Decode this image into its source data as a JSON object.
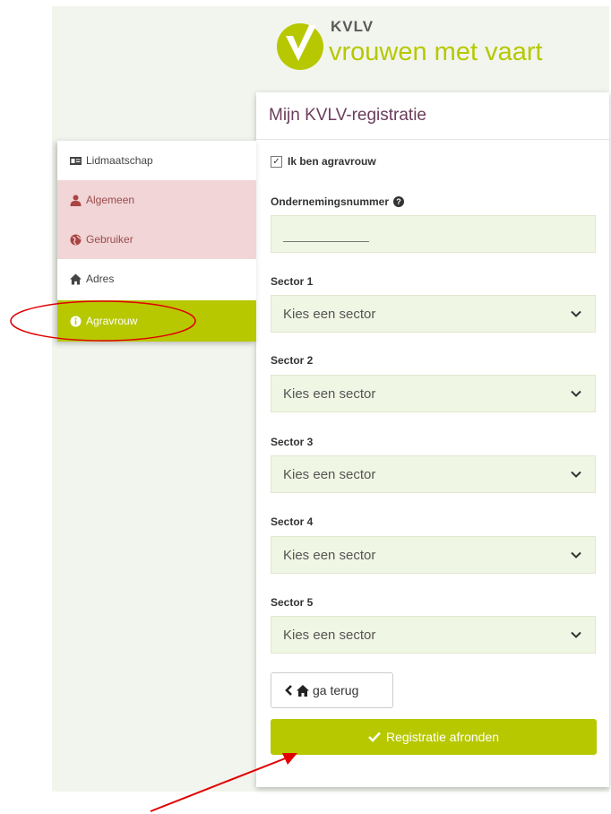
{
  "brand": {
    "name": "KVLV",
    "tagline": "vrouwen met vaart"
  },
  "card": {
    "title": "Mijn KVLV-registratie"
  },
  "checkbox": {
    "label": "Ik ben agravrouw",
    "checked": true
  },
  "company_number": {
    "label": "Ondernemingsnummer",
    "value": ""
  },
  "sectors": [
    {
      "label": "Sector 1",
      "placeholder": "Kies een sector"
    },
    {
      "label": "Sector 2",
      "placeholder": "Kies een sector"
    },
    {
      "label": "Sector 3",
      "placeholder": "Kies een sector"
    },
    {
      "label": "Sector 4",
      "placeholder": "Kies een sector"
    },
    {
      "label": "Sector 5",
      "placeholder": "Kies een sector"
    }
  ],
  "buttons": {
    "back": "ga terug",
    "submit": "Registratie afronden"
  },
  "sidebar": {
    "items": [
      {
        "label": "Lidmaatschap",
        "icon": "id-card-icon",
        "state": "default"
      },
      {
        "label": "Algemeen",
        "icon": "user-icon",
        "state": "error"
      },
      {
        "label": "Gebruiker",
        "icon": "globe-icon",
        "state": "error"
      },
      {
        "label": "Adres",
        "icon": "home-icon",
        "state": "default"
      },
      {
        "label": "Agravrouw",
        "icon": "info-circle-icon",
        "state": "active"
      }
    ]
  },
  "colors": {
    "brand_green": "#b7c800",
    "title_purple": "#6b3d5c",
    "error_bg": "#f1d5d7",
    "error_text": "#9b4c4c",
    "annotation_red": "#e00000"
  }
}
